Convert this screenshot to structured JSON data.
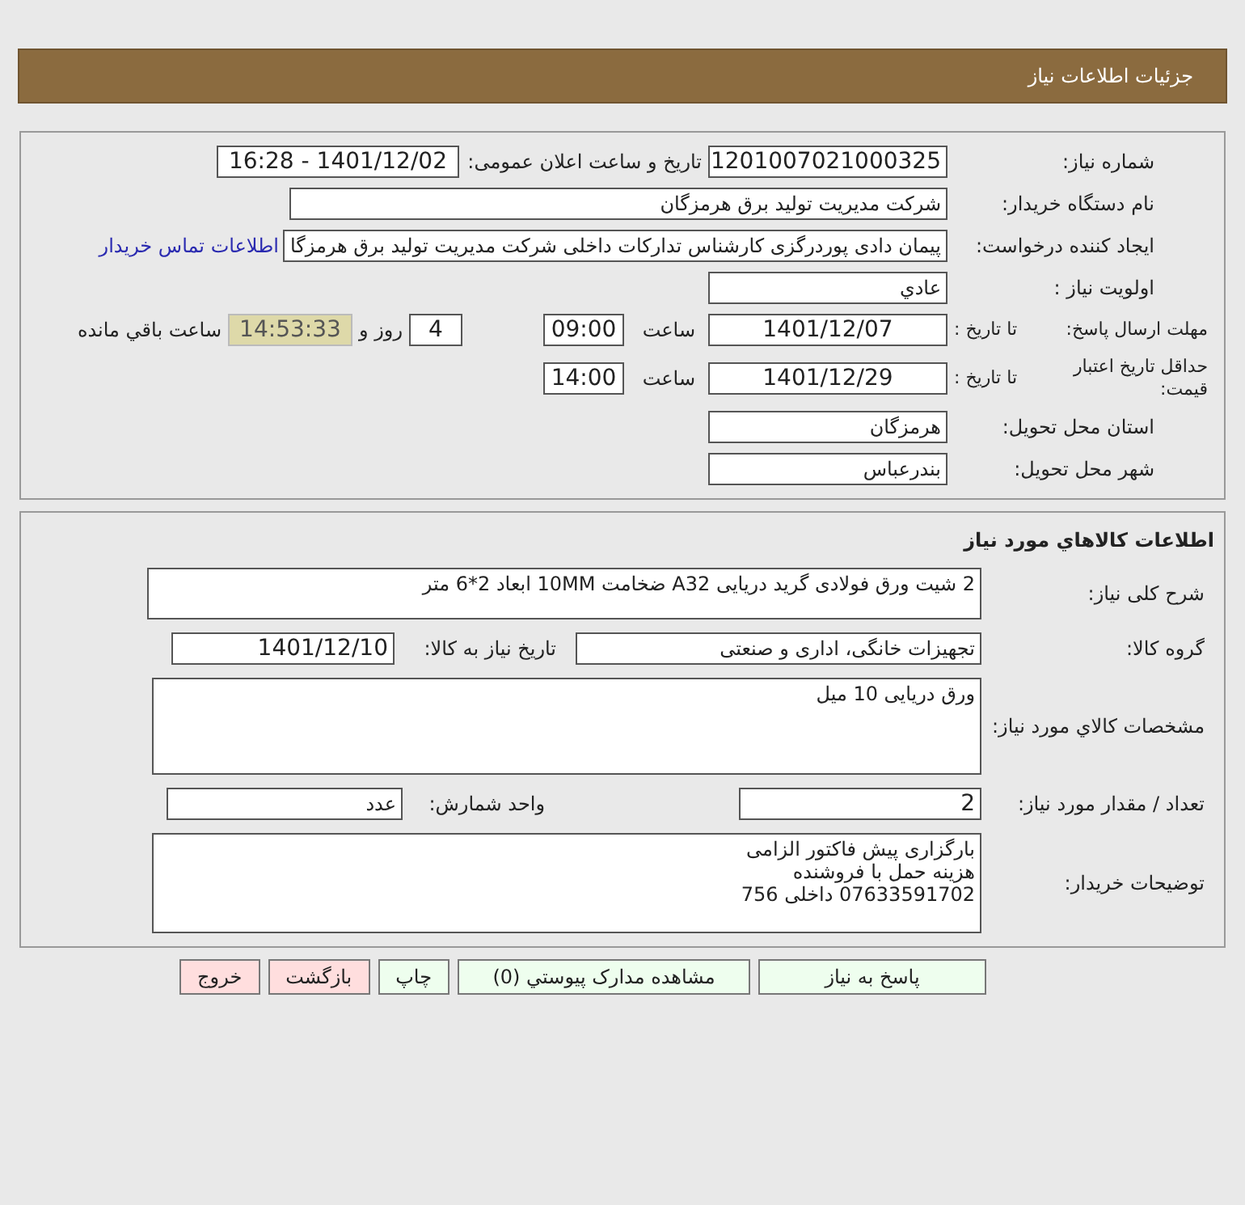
{
  "header": {
    "title": "جزئیات اطلاعات نیاز"
  },
  "need_number": {
    "label": "شماره نیاز:",
    "value": "1201007021000325"
  },
  "announce": {
    "label": "تاریخ و ساعت اعلان عمومی:",
    "value": "1401/12/02 - 16:28"
  },
  "buyer": {
    "label": "نام دستگاه خریدار:",
    "value": "شرکت مدیریت تولید برق هرمزگان"
  },
  "creator": {
    "label": "ایجاد کننده درخواست:",
    "value": "پیمان دادی پوردرگزی کارشناس تدارکات داخلی شرکت مدیریت تولید برق هرمزگا",
    "link": "اطلاعات تماس خریدار"
  },
  "priority": {
    "label": "اولویت نیاز :",
    "value": "عادي"
  },
  "reply_deadline": {
    "label": "مهلت ارسال پاسخ:",
    "to_label": "تا تاریخ :",
    "date": "1401/12/07",
    "time_label": "ساعت",
    "time": "09:00",
    "days": "4",
    "days_label": "روز و",
    "remaining": "14:53:33",
    "remaining_label": "ساعت باقي مانده"
  },
  "price_validity": {
    "label": "حداقل تاریخ اعتبار قیمت:",
    "to_label": "تا تاریخ :",
    "date": "1401/12/29",
    "time_label": "ساعت",
    "time": "14:00"
  },
  "province": {
    "label": "استان محل تحویل:",
    "value": "هرمزگان"
  },
  "city": {
    "label": "شهر محل تحویل:",
    "value": "بندرعباس"
  },
  "goods": {
    "title": "اطلاعات كالاهاي مورد نياز",
    "description": {
      "label": "شرح کلی نیاز:",
      "value": "2 شیت ورق فولادی گرید دریایی  A32 ضخامت 10MM ابعاد 2*6 متر"
    },
    "group": {
      "label": "گروه کالا:",
      "value": "تجهیزات خانگی، اداری و صنعتی",
      "date_label": "تاریخ نیاز به کالا:",
      "date": "1401/12/10"
    },
    "specs": {
      "label": "مشخصات كالاي مورد نياز:",
      "value": "ورق دریایی 10 میل"
    },
    "quantity": {
      "label": "تعداد / مقدار مورد نیاز:",
      "value": "2",
      "unit_label": "واحد شمارش:",
      "unit": "عدد"
    },
    "notes": {
      "label": "توضیحات خریدار:",
      "lines": [
        "بارگزاری پیش فاکتور الزامی",
        "هزینه حمل با فروشنده",
        "07633591702 داخلی 756"
      ]
    }
  },
  "buttons": [
    {
      "label": "پاسخ به نیاز",
      "kind": "primary"
    },
    {
      "label": "مشاهده مدارک پیوستي (0)",
      "kind": "primary"
    },
    {
      "label": "چاپ",
      "kind": "primary"
    },
    {
      "label": "بازگشت",
      "kind": "danger"
    },
    {
      "label": "خروج",
      "kind": "danger"
    }
  ]
}
